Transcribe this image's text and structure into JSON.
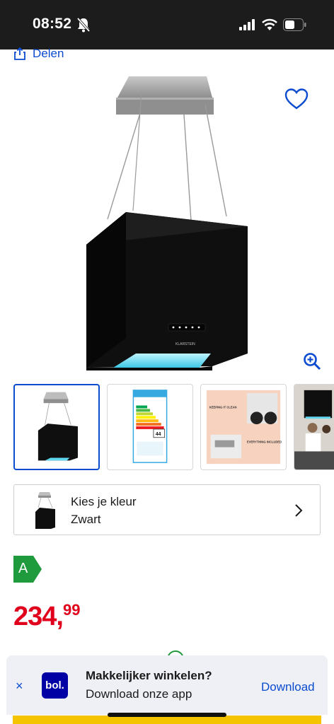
{
  "status_bar": {
    "time": "08:52",
    "icons": [
      "bell-muted-icon",
      "signal-icon",
      "wifi-icon",
      "battery-icon"
    ]
  },
  "share": {
    "label": "Delen",
    "icon": "share-icon"
  },
  "product": {
    "image_icon": "cooker-hood-image",
    "brand_on_image": "KLARSTEIN",
    "favorite_icon": "heart-icon",
    "zoom_icon": "zoom-in-icon"
  },
  "gallery": {
    "thumbnails": [
      {
        "name": "thumb-product",
        "selected": true
      },
      {
        "name": "thumb-energy-label",
        "selected": false,
        "energy_number": "44"
      },
      {
        "name": "thumb-features",
        "selected": false,
        "text1": "KEEPING IT CLEAN",
        "text2": "EVERYTHING INCLUDED"
      },
      {
        "name": "thumb-lifestyle",
        "selected": false
      }
    ]
  },
  "color_selector": {
    "label": "Kies je kleur",
    "value": "Zwart"
  },
  "energy_class": {
    "letter": "A",
    "color": "#1f9a3c"
  },
  "price": {
    "whole": "234,",
    "cents": "99",
    "color": "#e0001b"
  },
  "app_banner": {
    "title": "Makkelijker winkelen?",
    "subtitle": "Download onze app",
    "action": "Download",
    "logo_text": "bol.",
    "close": "×"
  },
  "colors": {
    "accent": "#0b4bcf",
    "status_bar_bg": "#1c1c1c",
    "cta_yellow": "#f5c400"
  }
}
